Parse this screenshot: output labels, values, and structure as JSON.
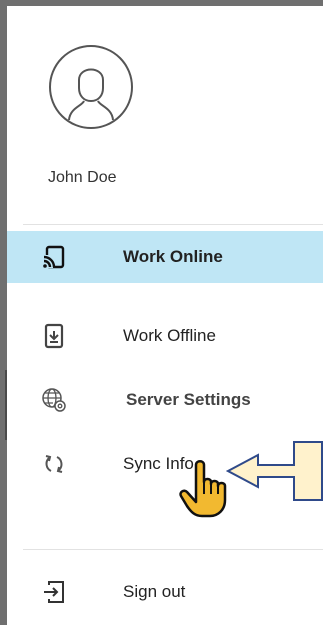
{
  "user": {
    "name": "John Doe"
  },
  "menu": {
    "items": [
      {
        "label": "Work Online",
        "icon": "cast-icon",
        "active": true
      },
      {
        "label": "Work Offline",
        "icon": "download-device-icon"
      },
      {
        "label": "Server Settings",
        "icon": "globe-settings-icon"
      },
      {
        "label": "Sync Info",
        "icon": "sync-icon"
      }
    ],
    "sign_out": {
      "label": "Sign out",
      "icon": "sign-out-icon"
    }
  },
  "colors": {
    "active_bg": "#bfe6f5",
    "callout_fill": "#fff2cc",
    "callout_stroke": "#2f4a8a",
    "cursor_fill": "#f2b930"
  }
}
